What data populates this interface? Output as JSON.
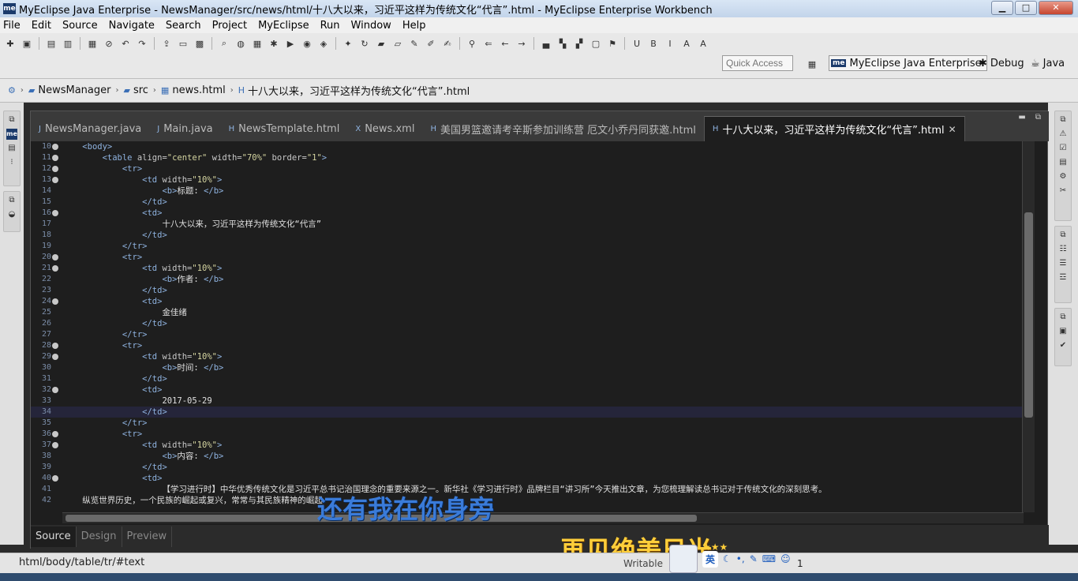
{
  "window": {
    "title": "MyEclipse Java Enterprise - NewsManager/src/news/html/十八大以来，习近平这样为传统文化“代言”.html - MyEclipse Enterprise Workbench",
    "minimize": "▁",
    "maximize": "□",
    "close": "✕"
  },
  "menu": [
    "File",
    "Edit",
    "Source",
    "Navigate",
    "Search",
    "Project",
    "MyEclipse",
    "Run",
    "Window",
    "Help"
  ],
  "quick_access_placeholder": "Quick Access",
  "perspectives": {
    "me_badge": "me",
    "me_label": "MyEclipse Java Enterprise",
    "debug": "Debug",
    "java": "Java"
  },
  "breadcrumb": [
    "NewsManager",
    "src",
    "news.html",
    "十八大以来，习近平这样为传统文化“代言”.html"
  ],
  "tabs": [
    {
      "label": "NewsManager.java",
      "icon": "J"
    },
    {
      "label": "Main.java",
      "icon": "J"
    },
    {
      "label": "NewsTemplate.html",
      "icon": "H"
    },
    {
      "label": "News.xml",
      "icon": "X"
    },
    {
      "label": "美国男篮邀请考辛斯参加训练营 厄文小乔丹同获邀.html",
      "icon": "H"
    },
    {
      "label": "十八大以来，习近平这样为传统文化“代言”.html",
      "icon": "H",
      "active": true
    }
  ],
  "code_lines": [
    {
      "n": "10",
      "fold": true,
      "indent": "    ",
      "parts": [
        [
          "tag",
          "<body>"
        ]
      ]
    },
    {
      "n": "11",
      "fold": true,
      "indent": "        ",
      "parts": [
        [
          "tag",
          "<table "
        ],
        [
          "attr",
          "align="
        ],
        [
          "val",
          "\"center\""
        ],
        [
          "attr",
          " width="
        ],
        [
          "val",
          "\"70%\""
        ],
        [
          "attr",
          " border="
        ],
        [
          "val",
          "\"1\""
        ],
        [
          "tag",
          ">"
        ]
      ]
    },
    {
      "n": "12",
      "fold": true,
      "indent": "            ",
      "parts": [
        [
          "tag",
          "<tr>"
        ]
      ]
    },
    {
      "n": "13",
      "fold": true,
      "indent": "                ",
      "parts": [
        [
          "tag",
          "<td "
        ],
        [
          "attr",
          "width="
        ],
        [
          "val",
          "\"10%\""
        ],
        [
          "tag",
          ">"
        ]
      ]
    },
    {
      "n": "14",
      "fold": false,
      "indent": "                    ",
      "parts": [
        [
          "tag",
          "<b>"
        ],
        [
          "plain",
          "标题: "
        ],
        [
          "tag",
          "</b>"
        ]
      ]
    },
    {
      "n": "15",
      "fold": false,
      "indent": "                ",
      "parts": [
        [
          "tag",
          "</td>"
        ]
      ]
    },
    {
      "n": "16",
      "fold": true,
      "indent": "                ",
      "parts": [
        [
          "tag",
          "<td>"
        ]
      ]
    },
    {
      "n": "17",
      "fold": false,
      "indent": "                    ",
      "parts": [
        [
          "plain",
          "十八大以来，习近平这样为传统文化“代言”"
        ]
      ]
    },
    {
      "n": "18",
      "fold": false,
      "indent": "                ",
      "parts": [
        [
          "tag",
          "</td>"
        ]
      ]
    },
    {
      "n": "19",
      "fold": false,
      "indent": "            ",
      "parts": [
        [
          "tag",
          "</tr>"
        ]
      ]
    },
    {
      "n": "20",
      "fold": true,
      "indent": "            ",
      "parts": [
        [
          "tag",
          "<tr>"
        ]
      ]
    },
    {
      "n": "21",
      "fold": true,
      "indent": "                ",
      "parts": [
        [
          "tag",
          "<td "
        ],
        [
          "attr",
          "width="
        ],
        [
          "val",
          "\"10%\""
        ],
        [
          "tag",
          ">"
        ]
      ]
    },
    {
      "n": "22",
      "fold": false,
      "indent": "                    ",
      "parts": [
        [
          "tag",
          "<b>"
        ],
        [
          "plain",
          "作者: "
        ],
        [
          "tag",
          "</b>"
        ]
      ]
    },
    {
      "n": "23",
      "fold": false,
      "indent": "                ",
      "parts": [
        [
          "tag",
          "</td>"
        ]
      ]
    },
    {
      "n": "24",
      "fold": true,
      "indent": "                ",
      "parts": [
        [
          "tag",
          "<td>"
        ]
      ]
    },
    {
      "n": "25",
      "fold": false,
      "indent": "                    ",
      "parts": [
        [
          "plain",
          "金佳绪"
        ]
      ]
    },
    {
      "n": "26",
      "fold": false,
      "indent": "                ",
      "parts": [
        [
          "tag",
          "</td>"
        ]
      ]
    },
    {
      "n": "27",
      "fold": false,
      "indent": "            ",
      "parts": [
        [
          "tag",
          "</tr>"
        ]
      ]
    },
    {
      "n": "28",
      "fold": true,
      "indent": "            ",
      "parts": [
        [
          "tag",
          "<tr>"
        ]
      ]
    },
    {
      "n": "29",
      "fold": true,
      "indent": "                ",
      "parts": [
        [
          "tag",
          "<td "
        ],
        [
          "attr",
          "width="
        ],
        [
          "val",
          "\"10%\""
        ],
        [
          "tag",
          ">"
        ]
      ]
    },
    {
      "n": "30",
      "fold": false,
      "indent": "                    ",
      "parts": [
        [
          "tag",
          "<b>"
        ],
        [
          "plain",
          "时间: "
        ],
        [
          "tag",
          "</b>"
        ]
      ]
    },
    {
      "n": "31",
      "fold": false,
      "indent": "                ",
      "parts": [
        [
          "tag",
          "</td>"
        ]
      ]
    },
    {
      "n": "32",
      "fold": true,
      "indent": "                ",
      "parts": [
        [
          "tag",
          "<td>"
        ]
      ]
    },
    {
      "n": "33",
      "fold": false,
      "indent": "                    ",
      "parts": [
        [
          "plain",
          "2017-05-29"
        ]
      ]
    },
    {
      "n": "34",
      "fold": false,
      "indent": "                ",
      "parts": [
        [
          "tag",
          "</td>"
        ]
      ],
      "current": true
    },
    {
      "n": "35",
      "fold": false,
      "indent": "            ",
      "parts": [
        [
          "tag",
          "</tr>"
        ]
      ]
    },
    {
      "n": "36",
      "fold": true,
      "indent": "            ",
      "parts": [
        [
          "tag",
          "<tr>"
        ]
      ]
    },
    {
      "n": "37",
      "fold": true,
      "indent": "                ",
      "parts": [
        [
          "tag",
          "<td "
        ],
        [
          "attr",
          "width="
        ],
        [
          "val",
          "\"10%\""
        ],
        [
          "tag",
          ">"
        ]
      ]
    },
    {
      "n": "38",
      "fold": false,
      "indent": "                    ",
      "parts": [
        [
          "tag",
          "<b>"
        ],
        [
          "plain",
          "内容: "
        ],
        [
          "tag",
          "</b>"
        ]
      ]
    },
    {
      "n": "39",
      "fold": false,
      "indent": "                ",
      "parts": [
        [
          "tag",
          "</td>"
        ]
      ]
    },
    {
      "n": "40",
      "fold": true,
      "indent": "                ",
      "parts": [
        [
          "tag",
          "<td>"
        ]
      ]
    },
    {
      "n": "41",
      "fold": false,
      "indent": "                    ",
      "parts": [
        [
          "plain",
          "【学习进行时】中华优秀传统文化是习近平总书记治国理念的重要来源之一。新华社《学习进行时》品牌栏目“讲习所”今天推出文章，为您梳理解读总书记对于传统文化的深刻思考。"
        ]
      ]
    },
    {
      "n": "42",
      "fold": false,
      "indent": "    ",
      "parts": [
        [
          "plain",
          "纵览世界历史，一个民族的崛起或复兴，常常与其民族精神的崛起"
        ]
      ]
    }
  ],
  "editor_subtabs": [
    "Source",
    "Design",
    "Preview"
  ],
  "status": {
    "path": "html/body/table/tr/#text",
    "writable": "Writable",
    "extra": "1"
  },
  "overlays": {
    "lyric_blue": "还有我在你身旁",
    "lyric_gold": "再见绝美日光"
  },
  "ime": {
    "lang": "英",
    "extra": "★★★"
  }
}
